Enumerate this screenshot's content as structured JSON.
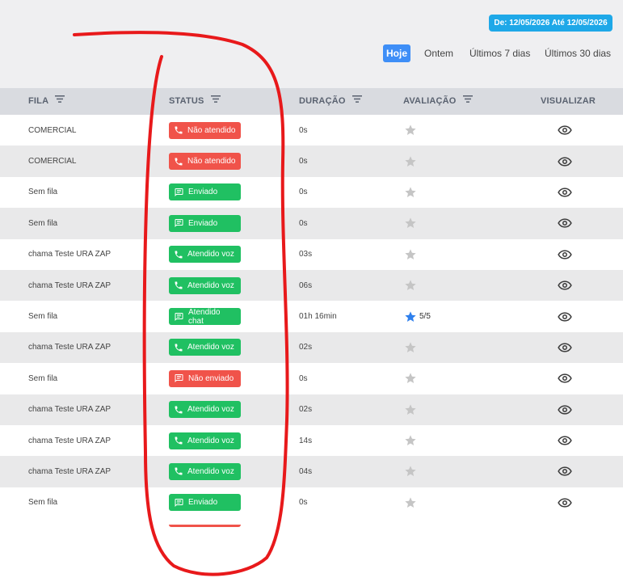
{
  "date_range": "De: 12/05/2026 Até 12/05/2026",
  "periods": [
    "Hoje",
    "Ontem",
    "Últimos 7 dias",
    "Últimos 30 dias"
  ],
  "active_period": "Hoje",
  "columns": {
    "fila": "FILA",
    "status": "STATUS",
    "duracao": "DURAÇÃO",
    "avaliacao": "AVALIAÇÃO",
    "visualizar": "VISUALIZAR"
  },
  "rows": [
    {
      "fila": "COMERCIAL",
      "status": "Não atendido",
      "status_kind": "phone",
      "status_color": "red",
      "duracao": "0s",
      "rating": ""
    },
    {
      "fila": "COMERCIAL",
      "status": "Não atendido",
      "status_kind": "phone",
      "status_color": "red",
      "duracao": "0s",
      "rating": ""
    },
    {
      "fila": "Sem fila",
      "status": "Enviado",
      "status_kind": "chat",
      "status_color": "green",
      "duracao": "0s",
      "rating": ""
    },
    {
      "fila": "Sem fila",
      "status": "Enviado",
      "status_kind": "chat",
      "status_color": "green",
      "duracao": "0s",
      "rating": ""
    },
    {
      "fila": "chama Teste URA ZAP",
      "status": "Atendido voz",
      "status_kind": "phone",
      "status_color": "green",
      "duracao": "03s",
      "rating": ""
    },
    {
      "fila": "chama Teste URA ZAP",
      "status": "Atendido voz",
      "status_kind": "phone",
      "status_color": "green",
      "duracao": "06s",
      "rating": ""
    },
    {
      "fila": "Sem fila",
      "status": "Atendido chat",
      "status_kind": "chat",
      "status_color": "green",
      "duracao": "01h 16min",
      "rating": "5/5"
    },
    {
      "fila": "chama Teste URA ZAP",
      "status": "Atendido voz",
      "status_kind": "phone",
      "status_color": "green",
      "duracao": "02s",
      "rating": ""
    },
    {
      "fila": "Sem fila",
      "status": "Não enviado",
      "status_kind": "chat",
      "status_color": "red",
      "duracao": "0s",
      "rating": ""
    },
    {
      "fila": "chama Teste URA ZAP",
      "status": "Atendido voz",
      "status_kind": "phone",
      "status_color": "green",
      "duracao": "02s",
      "rating": ""
    },
    {
      "fila": "chama Teste URA ZAP",
      "status": "Atendido voz",
      "status_kind": "phone",
      "status_color": "green",
      "duracao": "14s",
      "rating": ""
    },
    {
      "fila": "chama Teste URA ZAP",
      "status": "Atendido voz",
      "status_kind": "phone",
      "status_color": "green",
      "duracao": "04s",
      "rating": ""
    },
    {
      "fila": "Sem fila",
      "status": "Enviado",
      "status_kind": "chat",
      "status_color": "green",
      "duracao": "0s",
      "rating": ""
    }
  ],
  "colors": {
    "accent": "#3e8ef7",
    "date_badge": "#1ea8e8",
    "status_red": "#f0534a",
    "status_green": "#20c062",
    "star_empty": "#c5c5c5",
    "star_filled": "#2f80ed",
    "annotation": "#e8191b"
  },
  "icons": {
    "filter": "filter-lines-icon",
    "phone": "phone-icon",
    "chat": "chat-message-icon",
    "star": "star-icon",
    "view": "eye-icon"
  }
}
